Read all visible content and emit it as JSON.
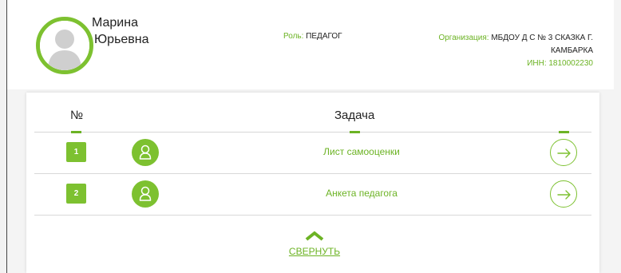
{
  "user": {
    "first_name": "Марина",
    "middle_name": "Юрьевна",
    "role_label": "Роль:",
    "role_value": "ПЕДАГОГ",
    "org_label": "Организация:",
    "org_value": "МБДОУ Д С № 3 СКАЗКА Г. КАМБАРКА",
    "inn": "ИНН: 1810002230",
    "avatar_icon": "person-silhouette-icon"
  },
  "table": {
    "col_num": "№",
    "col_task": "Задача",
    "rows": [
      {
        "num": "1",
        "title": "Лист самооценки",
        "icon": "user-icon",
        "action_icon": "arrow-right-icon"
      },
      {
        "num": "2",
        "title": "Анкета педагога",
        "icon": "user-icon",
        "action_icon": "arrow-right-icon"
      }
    ]
  },
  "collapse": {
    "label": "СВЕРНУТЬ",
    "icon": "chevron-up-icon"
  },
  "colors": {
    "accent": "#7dc130",
    "accent_text": "#6cb324"
  }
}
